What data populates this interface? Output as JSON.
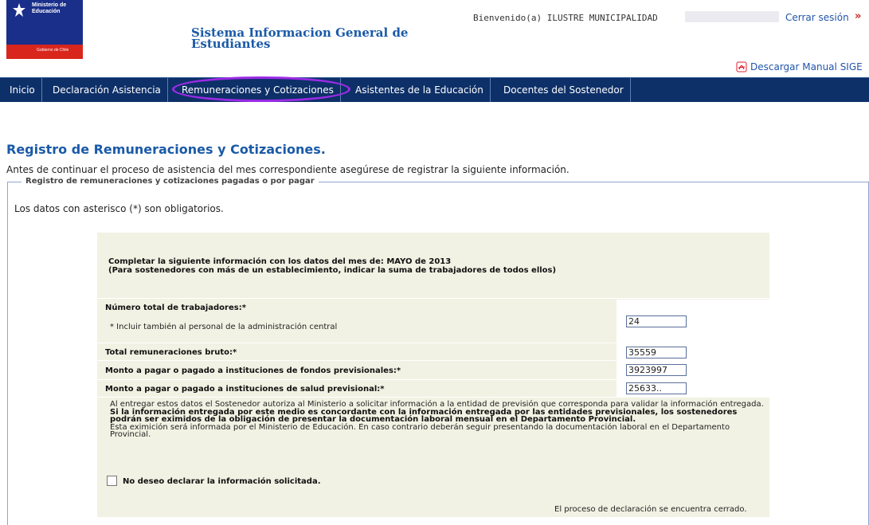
{
  "header": {
    "logo_line1": "Ministerio de",
    "logo_line2": "Educación",
    "logo_line3": "Gobierno de Chile",
    "system_title": "Sistema Informacion General de Estudiantes",
    "welcome": "Bienvenido(a) ILUSTRE MUNICIPALIDAD",
    "logout": "Cerrar sesión",
    "download_manual": "Descargar Manual SIGE"
  },
  "nav": {
    "items": [
      {
        "label": "Inicio"
      },
      {
        "label": "Declaración Asistencia"
      },
      {
        "label": "Remuneraciones y Cotizaciones"
      },
      {
        "label": "Asistentes de la Educación"
      },
      {
        "label": "Docentes del Sostenedor"
      }
    ],
    "active_index": 2
  },
  "main": {
    "title": "Registro de Remuneraciones y Cotizaciones.",
    "intro": "Antes de continuar el proceso de asistencia del mes correspondiente asegúrese de registrar la siguiente información.",
    "fieldset_legend": "Registro de remuneraciones y cotizaciones pagadas o por pagar",
    "required_note": "Los datos con asterisco (*) son obligatorios.",
    "period_line1": "Completar la siguiente información con los datos del mes de: MAYO de 2013",
    "period_line2": "(Para sostenedores con más de un establecimiento, indicar la suma de trabajadores de todos ellos)"
  },
  "form": {
    "total_workers_label": "Número total de trabajadores:*",
    "total_workers_note": "* Incluir también al personal de la administración central",
    "total_workers_value": "24",
    "gross_label": "Total remuneraciones bruto:*",
    "gross_value": "35559",
    "pension_label": "Monto a pagar o pagado a instituciones de fondos previsionales:*",
    "pension_value": "3923997",
    "health_label": "Monto a pagar o pagado a instituciones de salud previsional:*",
    "health_value": "25633.."
  },
  "disclaimer": {
    "p1": "Al entregar estos datos el Sostenedor autoriza al Ministerio a solicitar información a la entidad de previsión que corresponda para validar la información entregada.",
    "p2": "Si la información entregada por este medio es concordante con la información entregada por las entidades previsionales, los sostenedores podrán ser eximidos de la obligación de presentar la documentación laboral mensual en el Departamento Provincial.",
    "p3": "Esta eximición será informada por el Ministerio de Educación. En caso contrario deberán seguir presentando la documentación laboral en el Departamento Provincial."
  },
  "opt_out_label": "No deseo declarar la información solicitada.",
  "status_closed": "El proceso de declaración se encuentra cerrado.",
  "colors": {
    "nav_bg": "#0e3068",
    "title_blue": "#1a5aa8",
    "highlight": "#9b2be6",
    "panel_bg": "#f2f2e4"
  }
}
